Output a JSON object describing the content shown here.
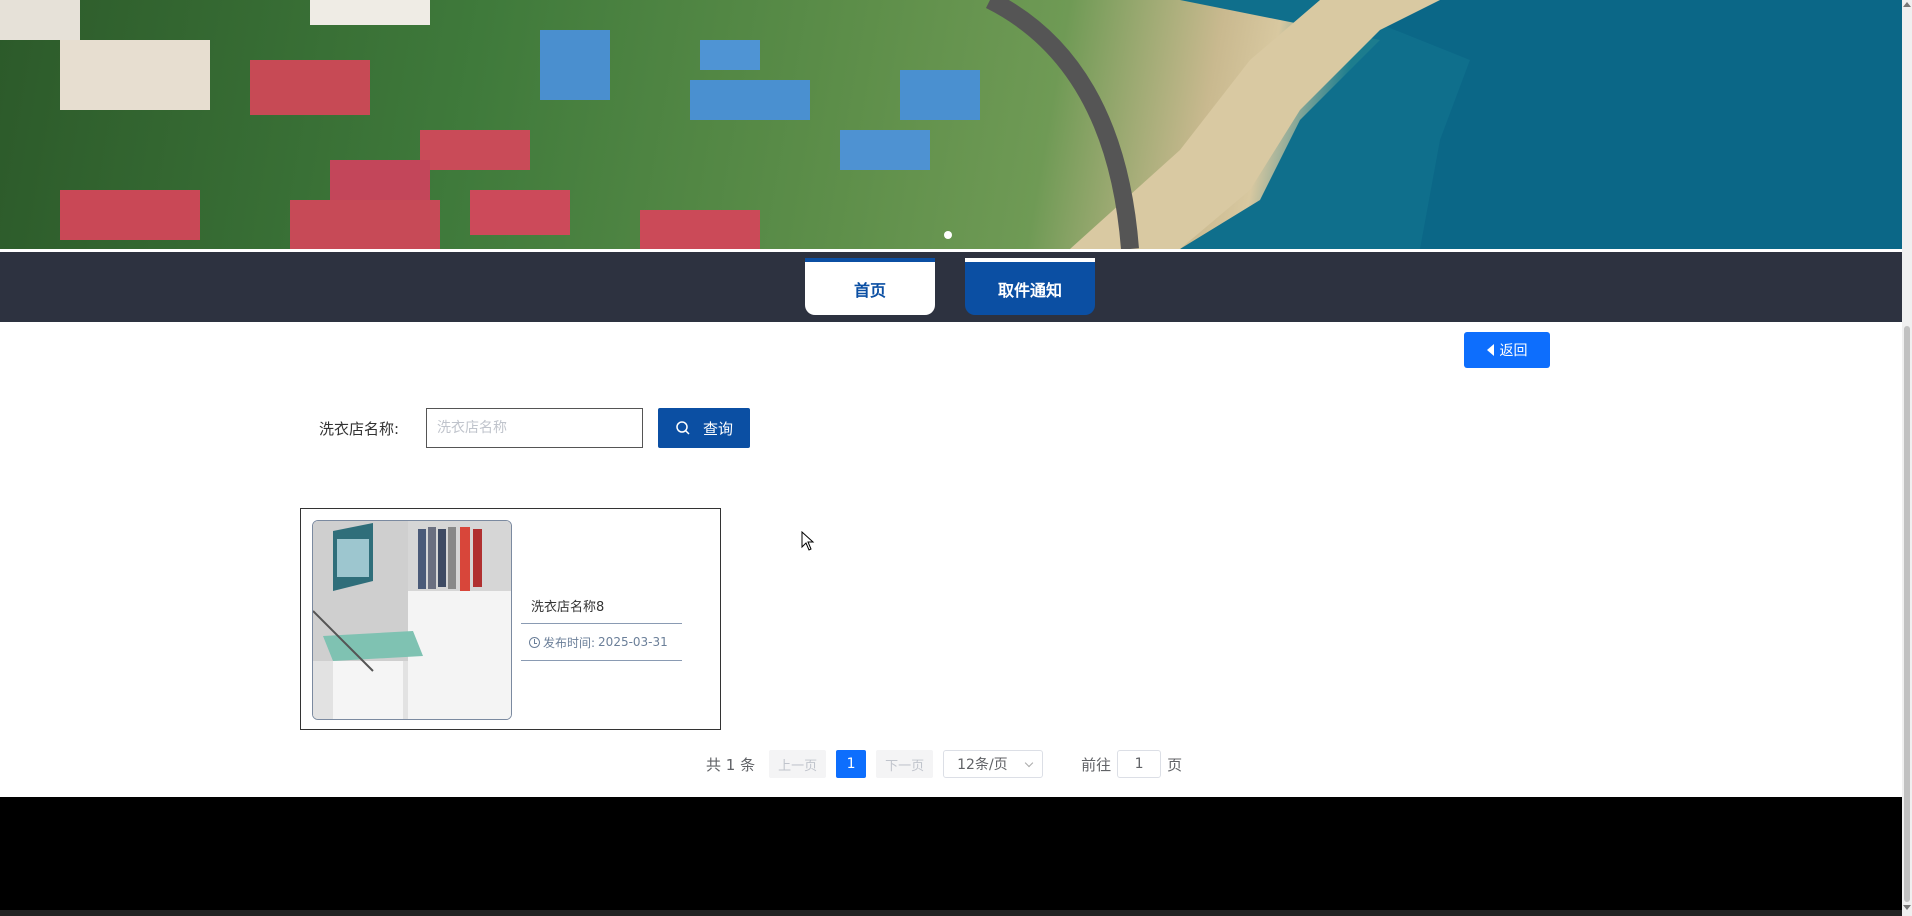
{
  "nav": {
    "tabs": [
      {
        "label": "首页",
        "active": true
      },
      {
        "label": "取件通知",
        "active": false
      }
    ]
  },
  "back_button": {
    "label": "返回",
    "icon": "caret-left-icon"
  },
  "search": {
    "label": "洗衣店名称:",
    "placeholder": "洗衣店名称",
    "value": "",
    "button_label": "查询",
    "button_icon": "search-icon"
  },
  "cards": [
    {
      "name": "洗衣店名称8",
      "publish_label": "发布时间:",
      "publish_date": "2025-03-31"
    }
  ],
  "pagination": {
    "total_text": "共 1 条",
    "prev_label": "上一页",
    "next_label": "下一页",
    "current_page": "1",
    "page_size": "12条/页",
    "goto_prefix": "前往",
    "goto_value": "1",
    "goto_suffix": "页"
  },
  "colors": {
    "primary": "#0b4fa3",
    "accent": "#0d6efd",
    "navbar": "#2d3240",
    "footer": "#000000"
  }
}
